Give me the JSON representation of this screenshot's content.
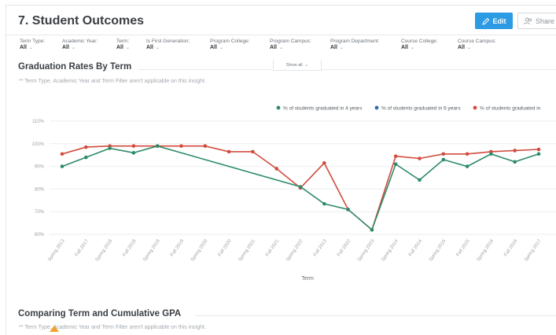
{
  "page": {
    "title": "7. Student Outcomes",
    "edit_label": "Edit",
    "share_label": "Share"
  },
  "filters": [
    {
      "label": "Term Type:",
      "value": "All"
    },
    {
      "label": "Academic Year:",
      "value": "All"
    },
    {
      "label": "Term:",
      "value": "All"
    },
    {
      "label": "Is First Generation:",
      "value": "All"
    },
    {
      "label": "Program College:",
      "value": "All"
    },
    {
      "label": "Program Campus:",
      "value": "All"
    },
    {
      "label": "Program Department:",
      "value": "All"
    },
    {
      "label": "Course College:",
      "value": "All"
    },
    {
      "label": "Course Campus:",
      "value": "All"
    }
  ],
  "show_all_label": "Show all",
  "sections": {
    "graduation": {
      "title": "Graduation Rates By Term",
      "note": "** Term Type, Academic Year and Term Filter aren't applicable on this insight."
    },
    "gpa": {
      "title": "Comparing Term and Cumulative GPA",
      "note": "** Term Type, Academic Year and Term Filter aren't applicable on this insight."
    }
  },
  "colors": {
    "series_4yr": "#2e8b6a",
    "series_6yr": "#2a6fb0",
    "series_other": "#d24b3e",
    "accent": "#2d9be3"
  },
  "chart_data": {
    "type": "line",
    "xlabel": "Term",
    "ylabel": "",
    "ylim": [
      60,
      110
    ],
    "y_ticks": [
      "60%",
      "70%",
      "80%",
      "90%",
      "100%",
      "110%"
    ],
    "categories": [
      "Spring 2013",
      "Fall 2017",
      "Spring 2018",
      "Fall 2018",
      "Spring 2019",
      "Fall 2019",
      "Spring 2020",
      "Fall 2020",
      "Spring 2021",
      "Fall 2021",
      "Spring 2022",
      "Fall 2013",
      "Fall 2022",
      "Spring 2023",
      "Spring 2014",
      "Fall 2014",
      "Spring 2015",
      "Fall 2015",
      "Spring 2016",
      "Fall 2016",
      "Spring 2017"
    ],
    "legend_position": "top-right",
    "series": [
      {
        "name": "% of students graduated in 4 years",
        "color": "#2e8b6a",
        "values": [
          90,
          94,
          98,
          96,
          99,
          null,
          null,
          null,
          null,
          null,
          81,
          73.5,
          71,
          62,
          91,
          84,
          93,
          90,
          95.5,
          92,
          95.5
        ]
      },
      {
        "name": "% of students graduated in 6 years",
        "color": "#2a6fb0",
        "values": []
      },
      {
        "name": "% of students graduated in",
        "color": "#d24b3e",
        "values": [
          95.5,
          98.5,
          99,
          99,
          99,
          99,
          99,
          96.5,
          96.5,
          89,
          80.5,
          91.5,
          71,
          62,
          94.5,
          93.5,
          95.5,
          95.5,
          96.5,
          97,
          97.5
        ]
      }
    ]
  }
}
